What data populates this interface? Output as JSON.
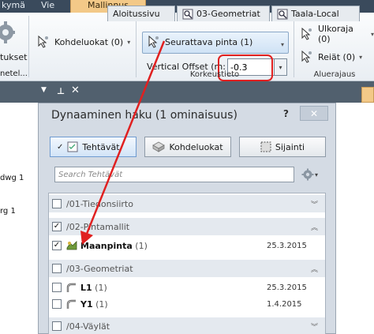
{
  "ribbon": {
    "tabs": [
      "kymä",
      "Vie",
      "Mallinnus"
    ],
    "active_tab": "Mallinnus",
    "partial_left_label1": "tukset",
    "partial_left_label2": "netel...",
    "kohdeluokat_label": "Kohdeluokat (0)",
    "seurattava_label": "Seurattava pinta (1)",
    "vertical_offset_label": "Vertical Offset (m:",
    "vertical_offset_value": "-0.3",
    "group_korkeustieto": "Korkeustieto",
    "ulkoraja_label": "Ulkoraja (0)",
    "reiat_label": "Reiät (0)",
    "group_aluerajaus": "Aluerajaus"
  },
  "doc_tabs": {
    "tabs": [
      "Aloitussivu",
      "03-Geometriat",
      "Taala-Local"
    ]
  },
  "left_tree": {
    "item1": "dwg 1",
    "item2": "rg 1"
  },
  "panel": {
    "title": "Dynaaminen haku (1 ominaisuus)",
    "help": "?",
    "close": "✕",
    "buttons": {
      "tehtavat": "Tehtävät",
      "kohdeluokat": "Kohdeluokat",
      "sijainti": "Sijainti"
    },
    "search_placeholder": "Search Tehtävät",
    "groups": [
      {
        "label": "/01-Tiedonsiirto",
        "checked": false,
        "chevron": "︾"
      },
      {
        "label": "/02-Pintamallit",
        "checked": true,
        "chevron": "︽"
      },
      {
        "label": "/03-Geometriat",
        "checked": false,
        "chevron": "︽"
      },
      {
        "label": "/04-Väylät",
        "checked": false,
        "chevron": "︾"
      }
    ],
    "items": [
      {
        "name": "Maanpinta",
        "count": "(1)",
        "date": "25.3.2015",
        "checked": true,
        "icon": "surface-icon"
      },
      {
        "name": "L1",
        "count": "(1)",
        "date": "25.3.2015",
        "checked": false,
        "icon": "alignment-icon"
      },
      {
        "name": "Y1",
        "count": "(1)",
        "date": "1.4.2015",
        "checked": false,
        "icon": "alignment-icon"
      }
    ],
    "check_mark": "✓"
  },
  "colors": {
    "annotation_red": "#e02020",
    "active_tab": "#f3c988",
    "panel_bg": "#d4dbe4"
  }
}
